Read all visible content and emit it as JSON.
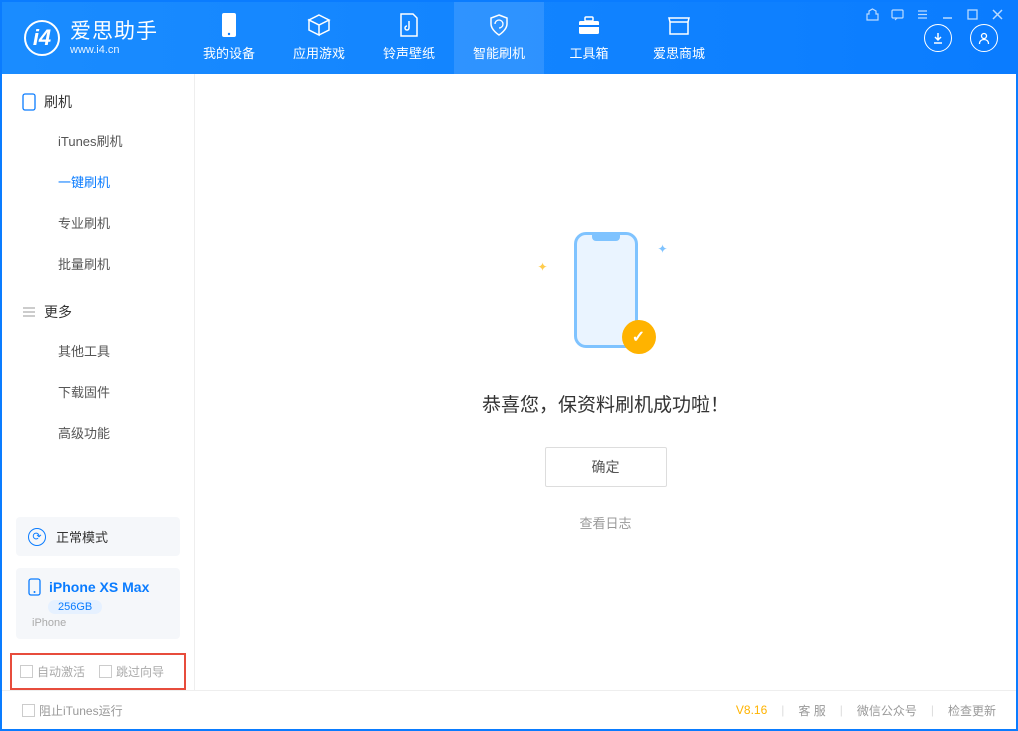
{
  "app": {
    "title": "爱思助手",
    "subtitle": "www.i4.cn"
  },
  "nav": {
    "items": [
      {
        "label": "我的设备"
      },
      {
        "label": "应用游戏"
      },
      {
        "label": "铃声壁纸"
      },
      {
        "label": "智能刷机"
      },
      {
        "label": "工具箱"
      },
      {
        "label": "爱思商城"
      }
    ]
  },
  "sidebar": {
    "section1": {
      "title": "刷机"
    },
    "items1": [
      {
        "label": "iTunes刷机"
      },
      {
        "label": "一键刷机"
      },
      {
        "label": "专业刷机"
      },
      {
        "label": "批量刷机"
      }
    ],
    "section2": {
      "title": "更多"
    },
    "items2": [
      {
        "label": "其他工具"
      },
      {
        "label": "下载固件"
      },
      {
        "label": "高级功能"
      }
    ]
  },
  "device": {
    "mode": "正常模式",
    "name": "iPhone XS Max",
    "capacity": "256GB",
    "type": "iPhone"
  },
  "options": {
    "auto_activate": "自动激活",
    "skip_guide": "跳过向导"
  },
  "main": {
    "success_text": "恭喜您，保资料刷机成功啦！",
    "ok_label": "确定",
    "log_label": "查看日志"
  },
  "footer": {
    "block_itunes": "阻止iTunes运行",
    "version": "V8.16",
    "links": [
      "客 服",
      "微信公众号",
      "检查更新"
    ]
  }
}
